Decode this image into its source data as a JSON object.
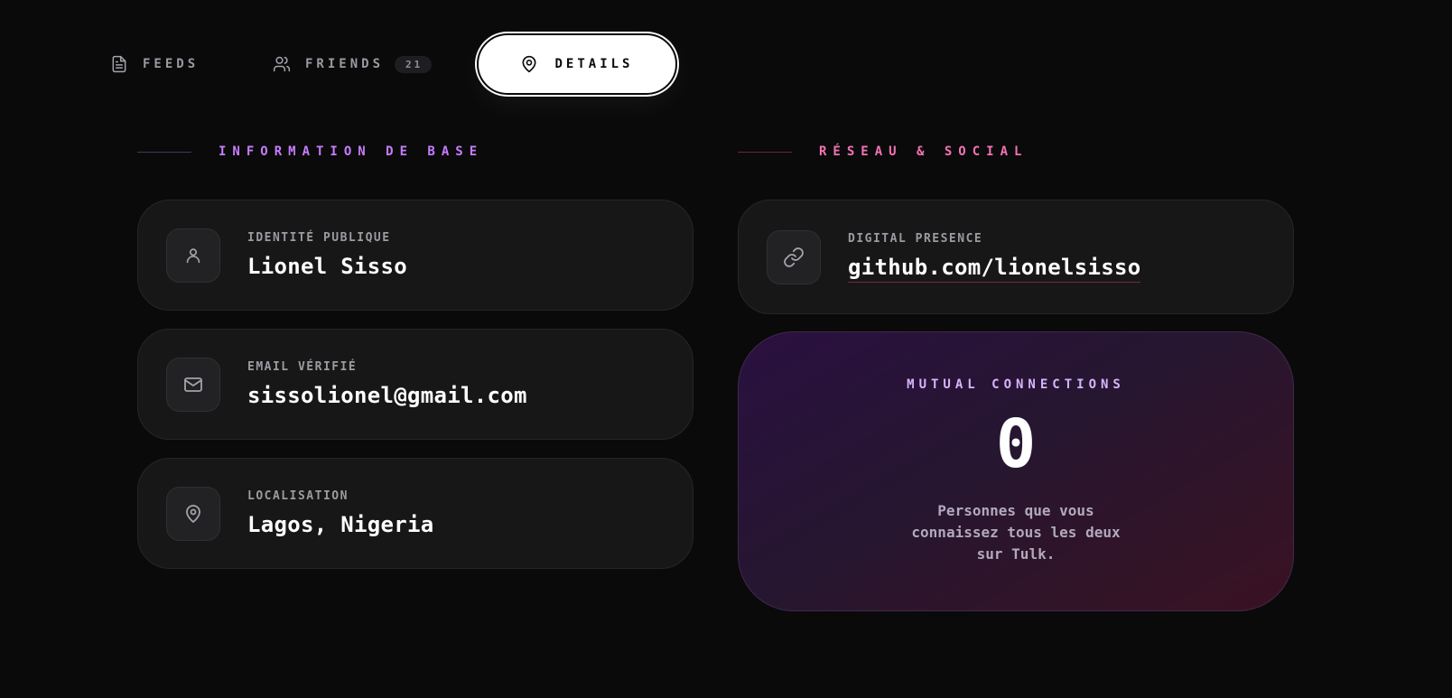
{
  "tabs": {
    "feeds": {
      "label": "FEEDS",
      "icon": "document-icon"
    },
    "friends": {
      "label": "FRIENDS",
      "count": "21",
      "icon": "users-icon"
    },
    "details": {
      "label": "DETAILS",
      "icon": "map-pin-icon",
      "active": true
    }
  },
  "basic_info": {
    "heading": "INFORMATION DE BASE",
    "accent": "#c77dff",
    "identity": {
      "label": "IDENTITÉ PUBLIQUE",
      "value": "Lionel Sisso",
      "icon": "user-icon"
    },
    "email": {
      "label": "EMAIL VÉRIFIÉ",
      "value": "sissolionel@gmail.com",
      "icon": "mail-icon"
    },
    "location": {
      "label": "LOCALISATION",
      "value": "Lagos, Nigeria",
      "icon": "map-pin-icon"
    }
  },
  "network": {
    "heading": "RÉSEAU & SOCIAL",
    "accent": "#f472b6",
    "digital": {
      "label": "DIGITAL PRESENCE",
      "value": "github.com/lionelsisso",
      "icon": "link-icon"
    },
    "mutual": {
      "title": "MUTUAL CONNECTIONS",
      "count": "0",
      "description": "Personnes que vous connaissez tous les deux sur Tulk."
    }
  }
}
